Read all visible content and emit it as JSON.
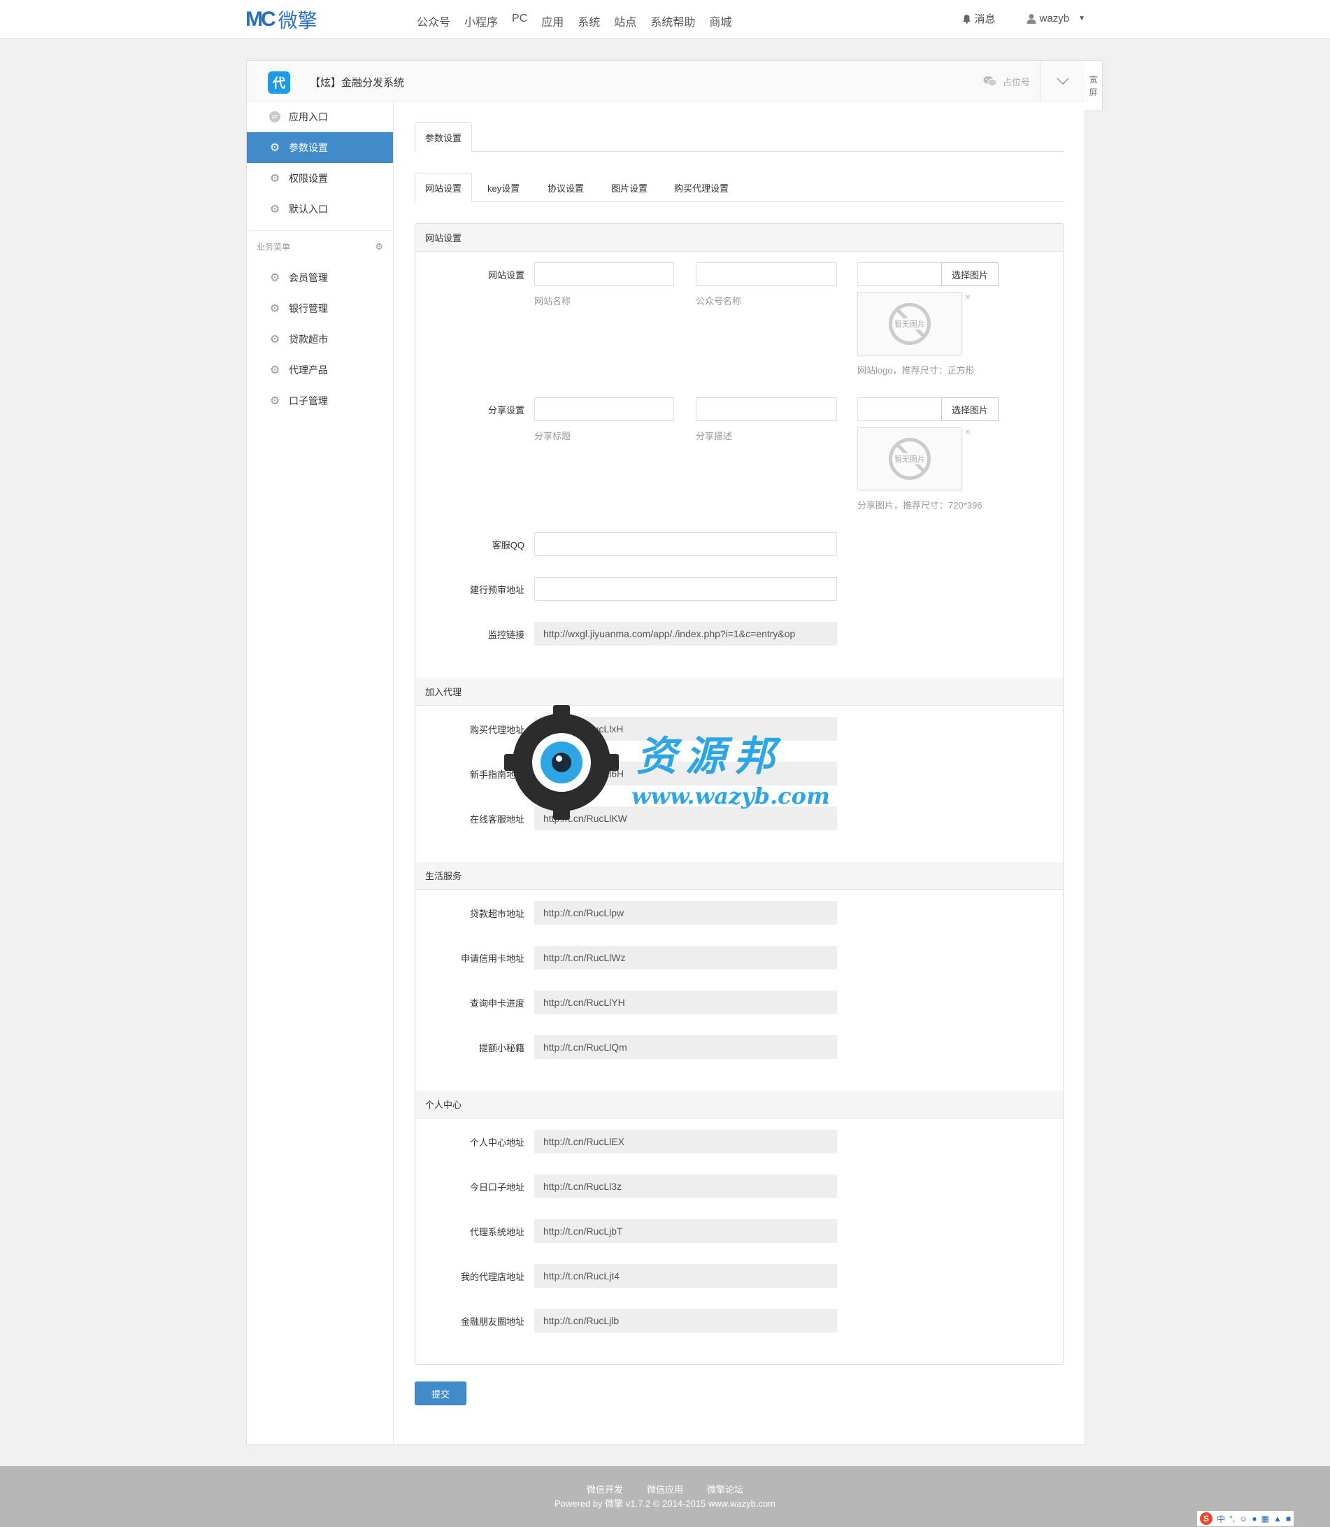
{
  "topbar": {
    "logo_mark": "MC",
    "logo_text": "微擎",
    "nav": [
      "公众号",
      "小程序",
      "PC",
      "应用",
      "系统",
      "站点",
      "系统帮助",
      "商城"
    ],
    "messages_label": "消息",
    "username": "wazyb"
  },
  "header": {
    "app_icon_text": "代",
    "app_title": "【炫】金融分发系统",
    "placeholder_account": "占位号",
    "wide_screen_label": [
      "宽",
      "屏"
    ]
  },
  "sidebar": {
    "top_items": [
      {
        "label": "应用入口",
        "icon": "comment-icon"
      },
      {
        "label": "参数设置",
        "icon": "gear-icon",
        "active": true
      },
      {
        "label": "权限设置",
        "icon": "gear-icon"
      },
      {
        "label": "默认入口",
        "icon": "gear-icon"
      }
    ],
    "group_title": "业务菜单",
    "group_items": [
      {
        "label": "会员管理",
        "icon": "gear-icon"
      },
      {
        "label": "银行管理",
        "icon": "gear-icon"
      },
      {
        "label": "贷款超市",
        "icon": "gear-icon"
      },
      {
        "label": "代理产品",
        "icon": "gear-icon"
      },
      {
        "label": "口子管理",
        "icon": "gear-icon"
      }
    ]
  },
  "tabs_main": [
    "参数设置"
  ],
  "tabs_sub": [
    "网站设置",
    "key设置",
    "协议设置",
    "图片设置",
    "购买代理设置"
  ],
  "sections": {
    "site": {
      "title": "网站设置",
      "site_row_label": "网站设置",
      "site_name_help": "网站名称",
      "mp_name_help": "公众号名称",
      "pick_button": "选择图片",
      "no_image": "暂无图片",
      "close_mark": "×",
      "logo_help": "网站logo，推荐尺寸：正方形",
      "share_row_label": "分享设置",
      "share_title_help": "分享标题",
      "share_desc_help": "分享描述",
      "share_img_help": "分享图片，推荐尺寸：720*396",
      "qq_label": "客服QQ",
      "ccb_label": "建行预审地址",
      "monitor_label": "监控链接",
      "monitor_value": "http://wxgl.jiyuanma.com/app/./index.php?i=1&c=entry&op"
    },
    "agent": {
      "title": "加入代理",
      "rows": [
        {
          "label": "购买代理地址",
          "value": "http://t.cn/RucLlxH"
        },
        {
          "label": "新手指南地址",
          "value": "http://t.cn/RucLl6H"
        },
        {
          "label": "在线客服地址",
          "value": "http://t.cn/RucLlKW"
        }
      ]
    },
    "life": {
      "title": "生活服务",
      "rows": [
        {
          "label": "贷款超市地址",
          "value": "http://t.cn/RucLlpw"
        },
        {
          "label": "申请信用卡地址",
          "value": "http://t.cn/RucLlWz"
        },
        {
          "label": "查询申卡进度",
          "value": "http://t.cn/RucLlYH"
        },
        {
          "label": "提额小秘籍",
          "value": "http://t.cn/RucLlQm"
        }
      ]
    },
    "personal": {
      "title": "个人中心",
      "rows": [
        {
          "label": "个人中心地址",
          "value": "http://t.cn/RucLlEX"
        },
        {
          "label": "今日口子地址",
          "value": "http://t.cn/RucLl3z"
        },
        {
          "label": "代理系统地址",
          "value": "http://t.cn/RucLjbT"
        },
        {
          "label": "我的代理店地址",
          "value": "http://t.cn/RucLjt4"
        },
        {
          "label": "金融朋友圈地址",
          "value": "http://t.cn/RucLjlb"
        }
      ]
    }
  },
  "submit_label": "提交",
  "watermark": {
    "cn": "资源邦",
    "url": "www.wazyb.com"
  },
  "footer": {
    "links": [
      "微信开发",
      "微信应用",
      "微擎论坛"
    ],
    "copyright": "Powered by 微擎 v1.7.2 © 2014-2015 www.wazyb.com"
  },
  "ime": {
    "logo": "S",
    "mode": "中"
  }
}
